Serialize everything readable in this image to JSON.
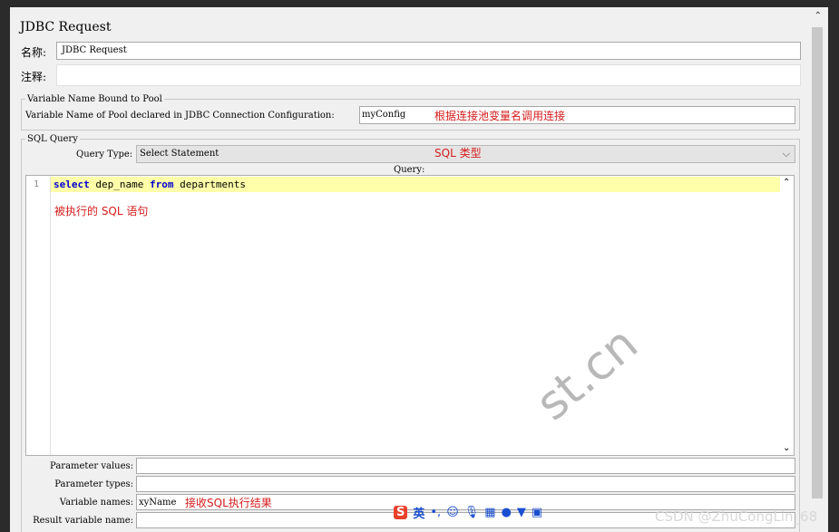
{
  "title": "JDBC Request",
  "name_label": "名称:",
  "name_value": "JDBC Request",
  "comment_label": "注释:",
  "pool_group": "Variable Name Bound to Pool",
  "pool_label": "Variable Name of Pool declared in JDBC Connection Configuration:",
  "pool_value": "myConfig",
  "pool_annotation": "根据连接池变量名调用连接",
  "sql_group": "SQL Query",
  "query_type_label": "Query Type:",
  "query_type_value": "Select Statement",
  "query_type_annotation": "SQL 类型",
  "query_label": "Query:",
  "code": {
    "line_number": "1",
    "kw_select": "select",
    "text1": " dep_name ",
    "kw_from": "from",
    "text2": " departments"
  },
  "code_annotation": "被执行的 SQL 语句",
  "params": {
    "values_label": "Parameter values:",
    "types_label": "Parameter types:",
    "varnames_label": "Variable names:",
    "varnames_value": "xyName",
    "varnames_annotation": "接收SQL执行结果",
    "result_label": "Result variable name:"
  },
  "ime": {
    "lang": "英"
  },
  "watermark": "CSDN @ZhuCongLin_68",
  "ghost_text": "st.cn"
}
